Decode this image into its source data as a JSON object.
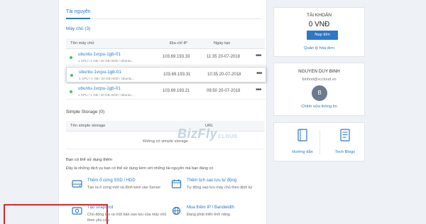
{
  "main": {
    "tab_label": "Tài nguyên",
    "servers": {
      "title": "Máy chủ (3)",
      "columns": [
        "Tên máy chủ",
        "Địa chỉ IP",
        "Ngày tạo"
      ],
      "rows": [
        {
          "name": "ubuntu-1vcpu-1gb-01",
          "spec": "1 CPU / 1 GB / 20 GB HDD / Ubuntu...",
          "ip": "103.69.193.33",
          "date": "11:35 20-07-2018",
          "highlighted": false
        },
        {
          "name": "ubuntu-1vcpu-1gb-01",
          "spec": "1 CPU / 1 GB / 20 GB HDD / Ubuntu...",
          "ip": "103.69.193.31",
          "date": "10:35 20-07-2018",
          "highlighted": true
        },
        {
          "name": "ubuntu-1vcpu-1gb-01",
          "spec": "1 CPU / 1 GB / 20 GB HDD / Ubuntu...",
          "ip": "103.69.193.21",
          "date": "09:50 20-07-2018",
          "highlighted": false
        }
      ],
      "more_label": "•••"
    },
    "storage": {
      "title": "Simple Storage (0)",
      "columns": [
        "Tên simple storage",
        "URL"
      ],
      "empty_text": "Không có simple storage"
    },
    "watermark": {
      "text": "BizFly",
      "sub": "CLOUD"
    },
    "services": {
      "title": "Bạn có thể sử dụng thêm",
      "description": "Đây là những dịch vụ bạn có thể sử dụng kèm với những tài nguyên mà bạn đang có",
      "items": [
        {
          "title": "Thêm ổ cứng SSD / HDD",
          "desc": "Tạo ra ổ cứng mới và đính kèm vào Server",
          "icon": "hard-drive-icon"
        },
        {
          "title": "Thêm lịch sao lưu tự động",
          "desc": "Tự động sao lưu máy chủ theo định kỳ",
          "icon": "calendar-icon"
        },
        {
          "title": "Tạo snapshot",
          "desc": "Chủ động tạo ra một bản sao lưu của máy chủ theo yêu cầu",
          "icon": "snapshot-icon"
        },
        {
          "title": "Mua thêm IP / Bandwidth",
          "desc": "Đang phát triển tính năng",
          "icon": "network-icon"
        }
      ]
    }
  },
  "sidebar": {
    "account": {
      "title": "TÀI KHOẢN",
      "balance": "0 VNĐ",
      "topup_label": "Nạp tiền",
      "invoice_link": "Quản lý hóa đơn"
    },
    "profile": {
      "name": "NGUYEN DUY BINH",
      "email": "binhnd@vccloud.vn",
      "avatar_letter": "B",
      "edit_link": "Chỉnh sửa thông tin"
    },
    "quick_links": [
      {
        "label": "Hướng dẫn",
        "icon": "guide-icon"
      },
      {
        "label": "Tech Blogs",
        "icon": "blog-icon"
      }
    ]
  },
  "colors": {
    "accent": "#2b78c5",
    "status_running": "#4cbd6b",
    "highlight_border": "#d9272e"
  }
}
